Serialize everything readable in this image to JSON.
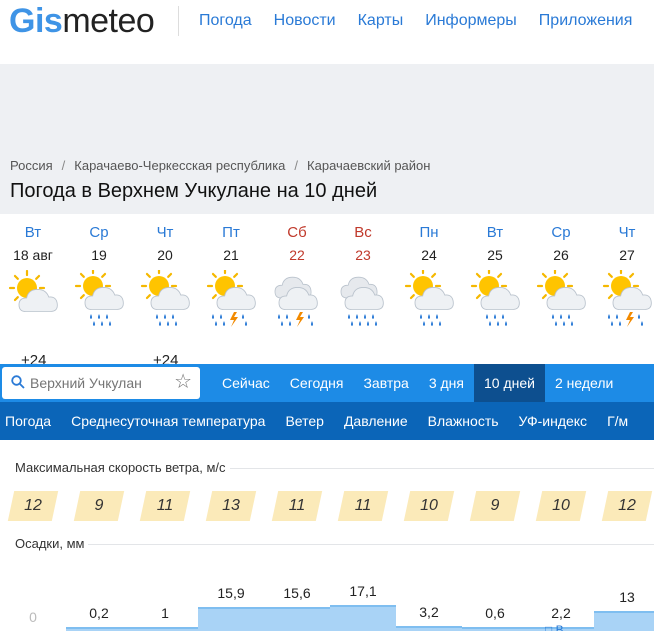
{
  "header": {
    "logo_part1": "Gis",
    "logo_part2": "meteo",
    "nav": [
      "Погода",
      "Новости",
      "Карты",
      "Информеры",
      "Приложения"
    ]
  },
  "breadcrumb": [
    "Россия",
    "Карачаево-Черкесская республика",
    "Карачаевский район"
  ],
  "page_title": "Погода в Верхнем Учкулане на 10 дней",
  "days": [
    {
      "dow": "Вт",
      "date": "18 авг",
      "weekend": false,
      "icon": "partly-cloudy"
    },
    {
      "dow": "Ср",
      "date": "19",
      "weekend": false,
      "icon": "partly-cloudy-rain"
    },
    {
      "dow": "Чт",
      "date": "20",
      "weekend": false,
      "icon": "partly-cloudy-rain"
    },
    {
      "dow": "Пт",
      "date": "21",
      "weekend": false,
      "icon": "partly-cloudy-thunder-rain"
    },
    {
      "dow": "Сб",
      "date": "22",
      "weekend": true,
      "icon": "cloudy-thunder-rain"
    },
    {
      "dow": "Вс",
      "date": "23",
      "weekend": true,
      "icon": "cloudy-heavy-rain"
    },
    {
      "dow": "Пн",
      "date": "24",
      "weekend": false,
      "icon": "partly-cloudy-rain"
    },
    {
      "dow": "Вт",
      "date": "25",
      "weekend": false,
      "icon": "partly-cloudy-rain"
    },
    {
      "dow": "Ср",
      "date": "26",
      "weekend": false,
      "icon": "partly-cloudy-rain"
    },
    {
      "dow": "Чт",
      "date": "27",
      "weekend": false,
      "icon": "partly-cloudy-thunder-rain"
    }
  ],
  "temp_peek": [
    "+24",
    "+24"
  ],
  "search": {
    "placeholder": "Верхний Учкулан"
  },
  "tabs": [
    {
      "label": "Сейчас",
      "active": false
    },
    {
      "label": "Сегодня",
      "active": false
    },
    {
      "label": "Завтра",
      "active": false
    },
    {
      "label": "3 дня",
      "active": false
    },
    {
      "label": "10 дней",
      "active": true
    },
    {
      "label": "2 недели",
      "active": false
    }
  ],
  "subnav": [
    "Погода",
    "Среднесуточная температура",
    "Ветер",
    "Давление",
    "Влажность",
    "УФ-индекс",
    "Г/м"
  ],
  "wind": {
    "label": "Максимальная скорость ветра, м/с",
    "values": [
      "12",
      "9",
      "11",
      "13",
      "11",
      "11",
      "10",
      "9",
      "10",
      "12"
    ]
  },
  "precip": {
    "label": "Осадки, мм",
    "labels": [
      "0",
      "0,2",
      "1",
      "15,9",
      "15,6",
      "17,1",
      "3,2",
      "0,6",
      "2,2",
      "13"
    ],
    "amounts": [
      0,
      0.2,
      1,
      15.9,
      15.6,
      17.1,
      3.2,
      0.6,
      2.2,
      13
    ]
  },
  "colors": {
    "brand_blue": "#3f94e6",
    "bar_blue": "#1d8be6",
    "subnav_blue": "#0b65b8",
    "active_tab": "#0d4f8f",
    "wind_badge": "#fbeab9",
    "precip_fill": "#a9d3f6",
    "weekend_red": "#c0392b"
  }
}
